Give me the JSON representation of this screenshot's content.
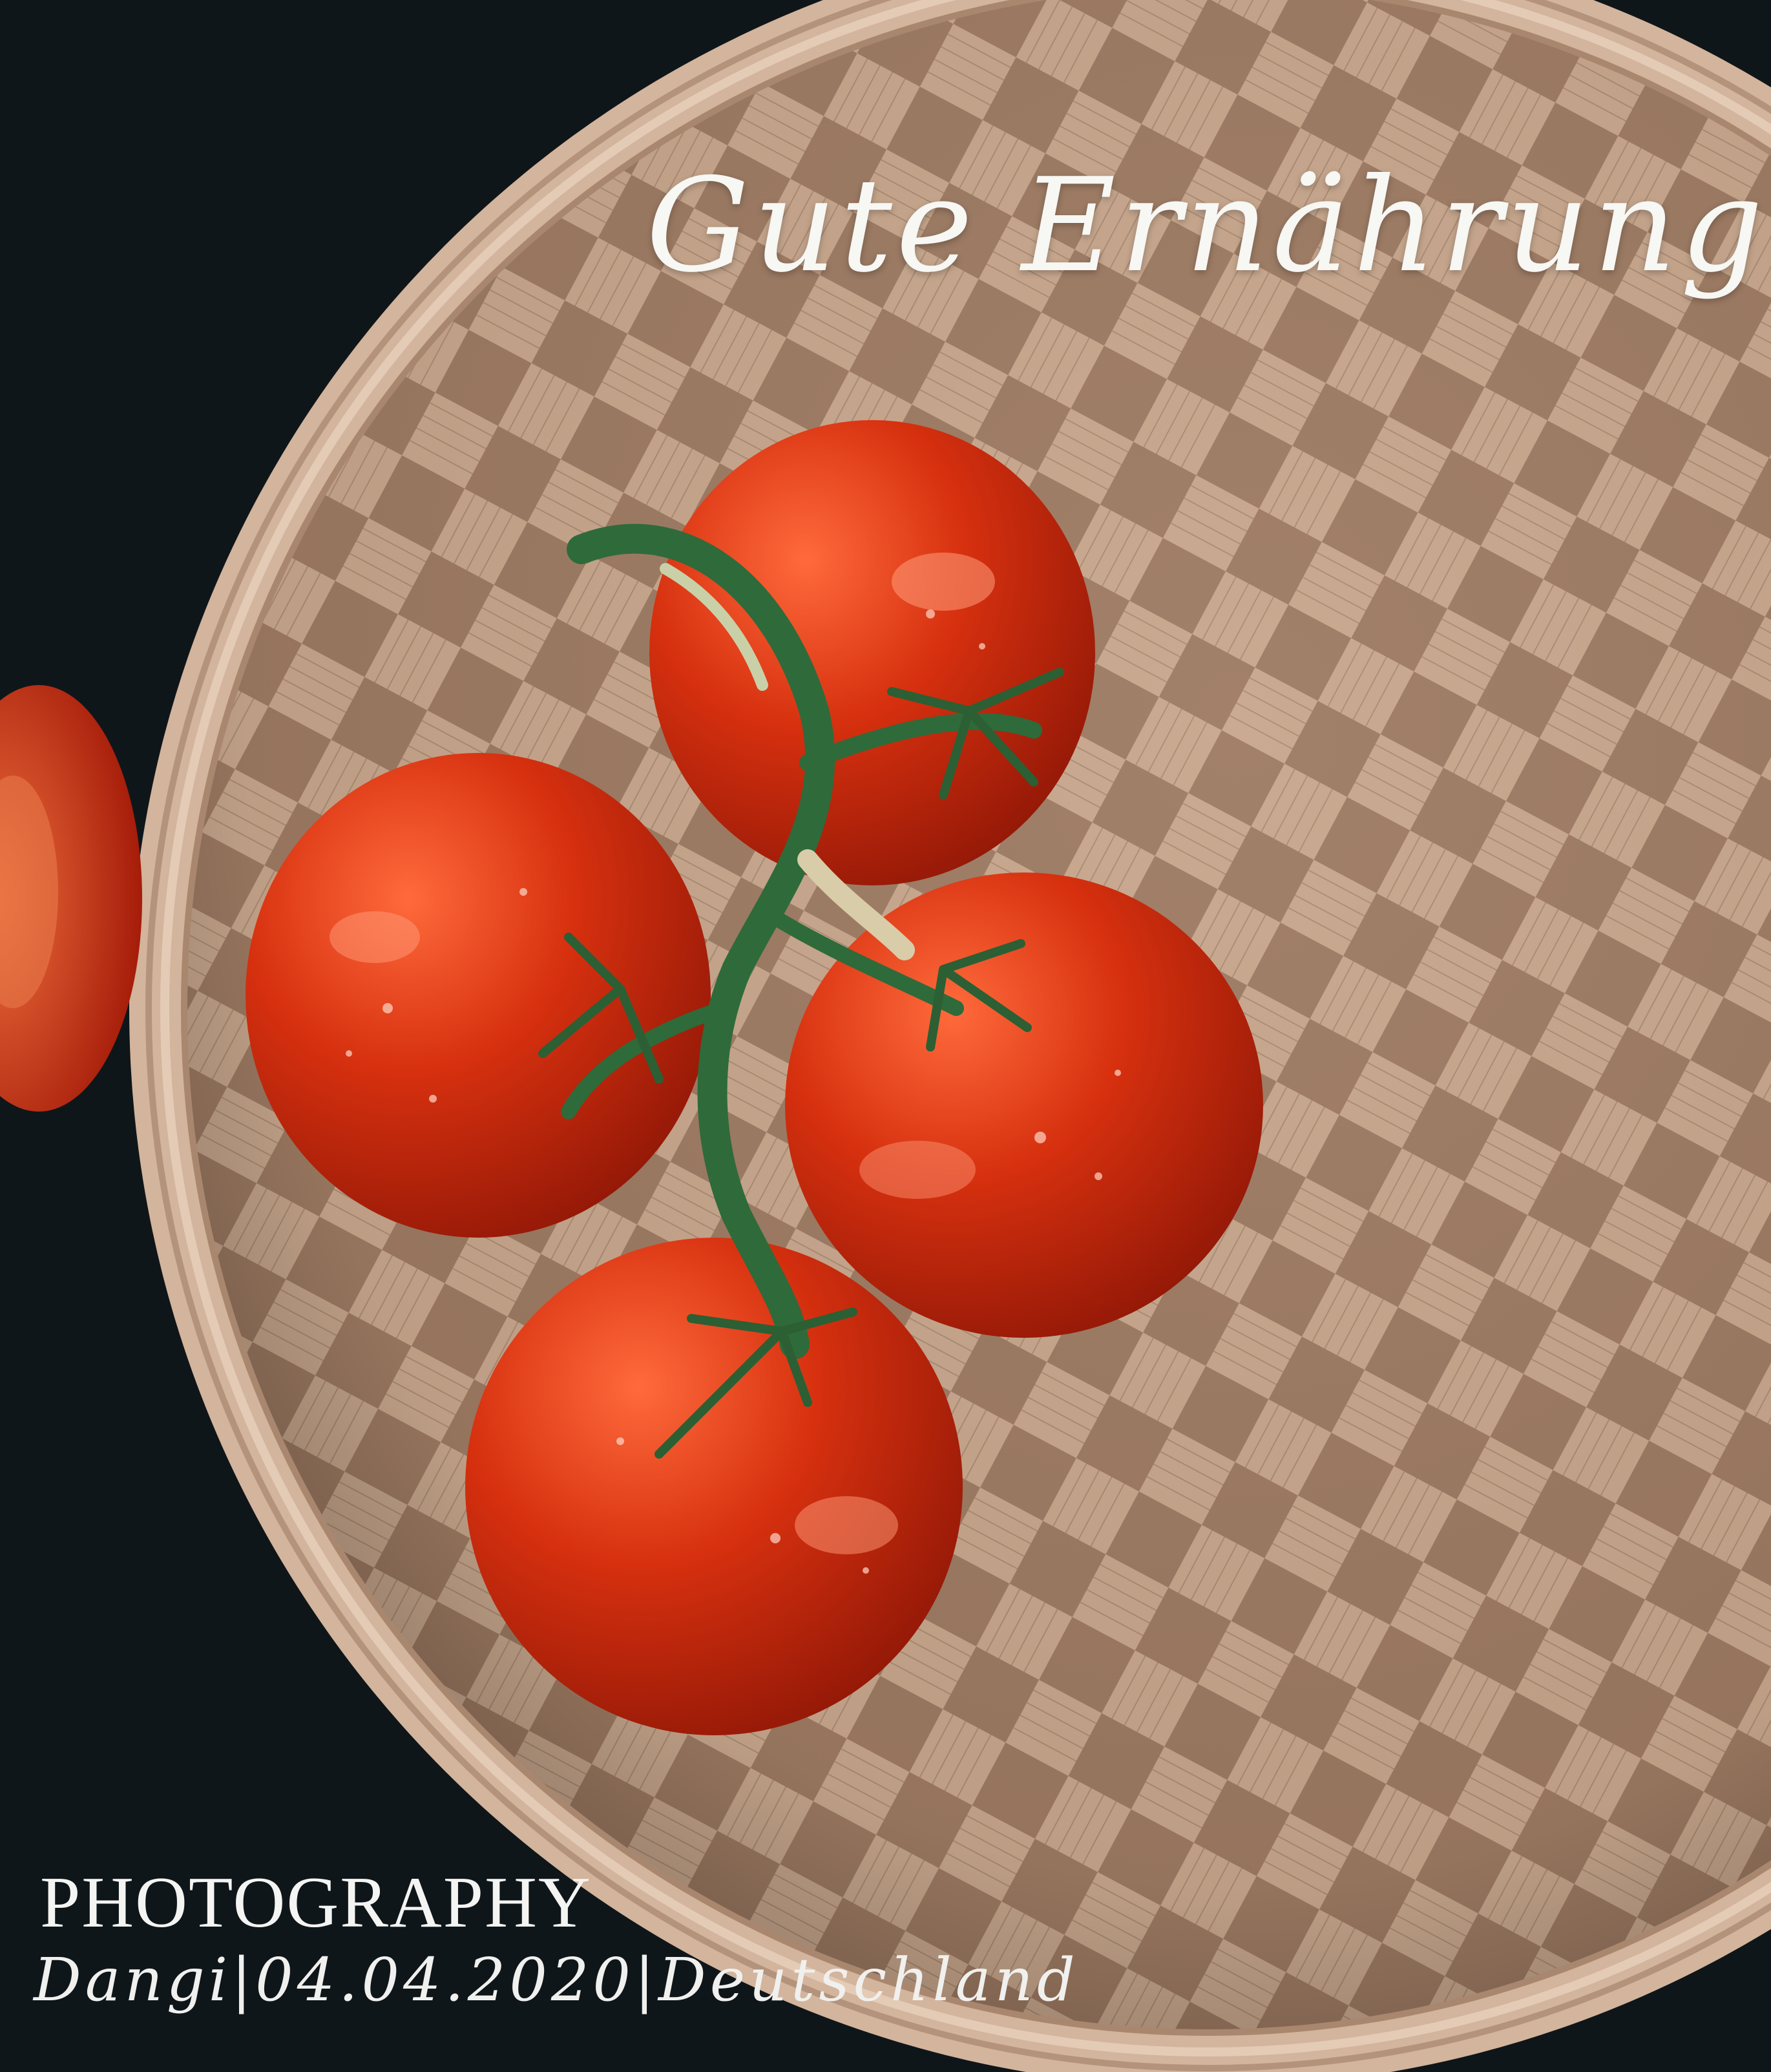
{
  "photo": {
    "headline": "Gute Ernährung",
    "caption_title": "PHOTOGRAPHY",
    "caption_line": "Dangi|04.04.2020|Deutschland",
    "colors": {
      "background": "#0f161a",
      "basket": "#b99a82",
      "basket_rim": "#d8bda7",
      "tomato": "#c8260f",
      "stem": "#2f6a3a",
      "text": "#f7f7f4"
    }
  }
}
